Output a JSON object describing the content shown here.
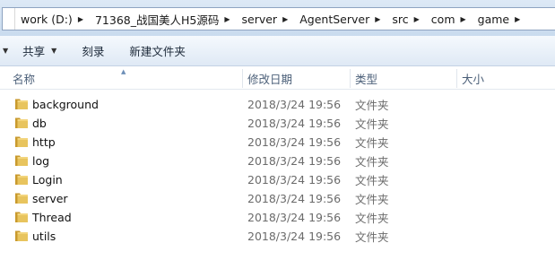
{
  "address_bar": {
    "crumbs": [
      "work (D:)",
      "71368_战国美人H5源码",
      "server",
      "AgentServer",
      "src",
      "com",
      "game"
    ]
  },
  "toolbar": {
    "share_label": "共享",
    "burn_label": "刻录",
    "new_folder_label": "新建文件夹"
  },
  "columns": {
    "name": "名称",
    "date_modified": "修改日期",
    "type": "类型",
    "size": "大小"
  },
  "files": [
    {
      "name": "background",
      "date": "2018/3/24 19:56",
      "type": "文件夹",
      "icon": "folder-icon"
    },
    {
      "name": "db",
      "date": "2018/3/24 19:56",
      "type": "文件夹",
      "icon": "folder-icon"
    },
    {
      "name": "http",
      "date": "2018/3/24 19:56",
      "type": "文件夹",
      "icon": "folder-icon"
    },
    {
      "name": "log",
      "date": "2018/3/24 19:56",
      "type": "文件夹",
      "icon": "folder-icon"
    },
    {
      "name": "Login",
      "date": "2018/3/24 19:56",
      "type": "文件夹",
      "icon": "folder-icon"
    },
    {
      "name": "server",
      "date": "2018/3/24 19:56",
      "type": "文件夹",
      "icon": "folder-icon"
    },
    {
      "name": "Thread",
      "date": "2018/3/24 19:56",
      "type": "文件夹",
      "icon": "folder-icon"
    },
    {
      "name": "utils",
      "date": "2018/3/24 19:56",
      "type": "文件夹",
      "icon": "folder-icon"
    }
  ],
  "colors": {
    "folder_fill": "#e8c45e",
    "folder_dark": "#c99a2e",
    "header_text": "#4b5f78",
    "meta_text": "#6b6b6b"
  }
}
